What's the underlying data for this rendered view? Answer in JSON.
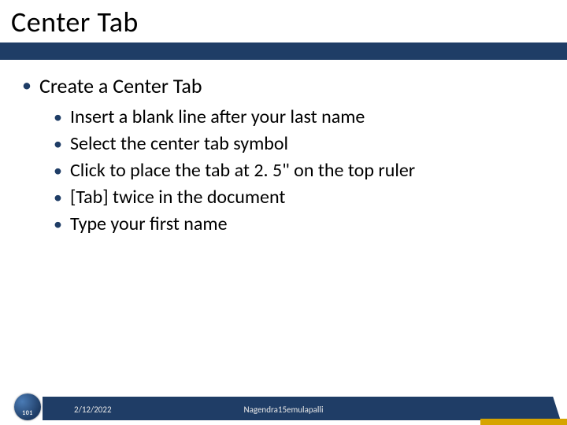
{
  "title": "Center Tab",
  "content": {
    "l1": "Create a Center Tab",
    "l2": [
      "Insert a blank line after your last name",
      "Select the center tab symbol",
      "Click to place the tab at 2. 5\" on the top ruler",
      "[Tab] twice in the document",
      "Type your first name"
    ]
  },
  "footer": {
    "date": "2/12/2022",
    "author": "Nagendra15emulapalli"
  }
}
